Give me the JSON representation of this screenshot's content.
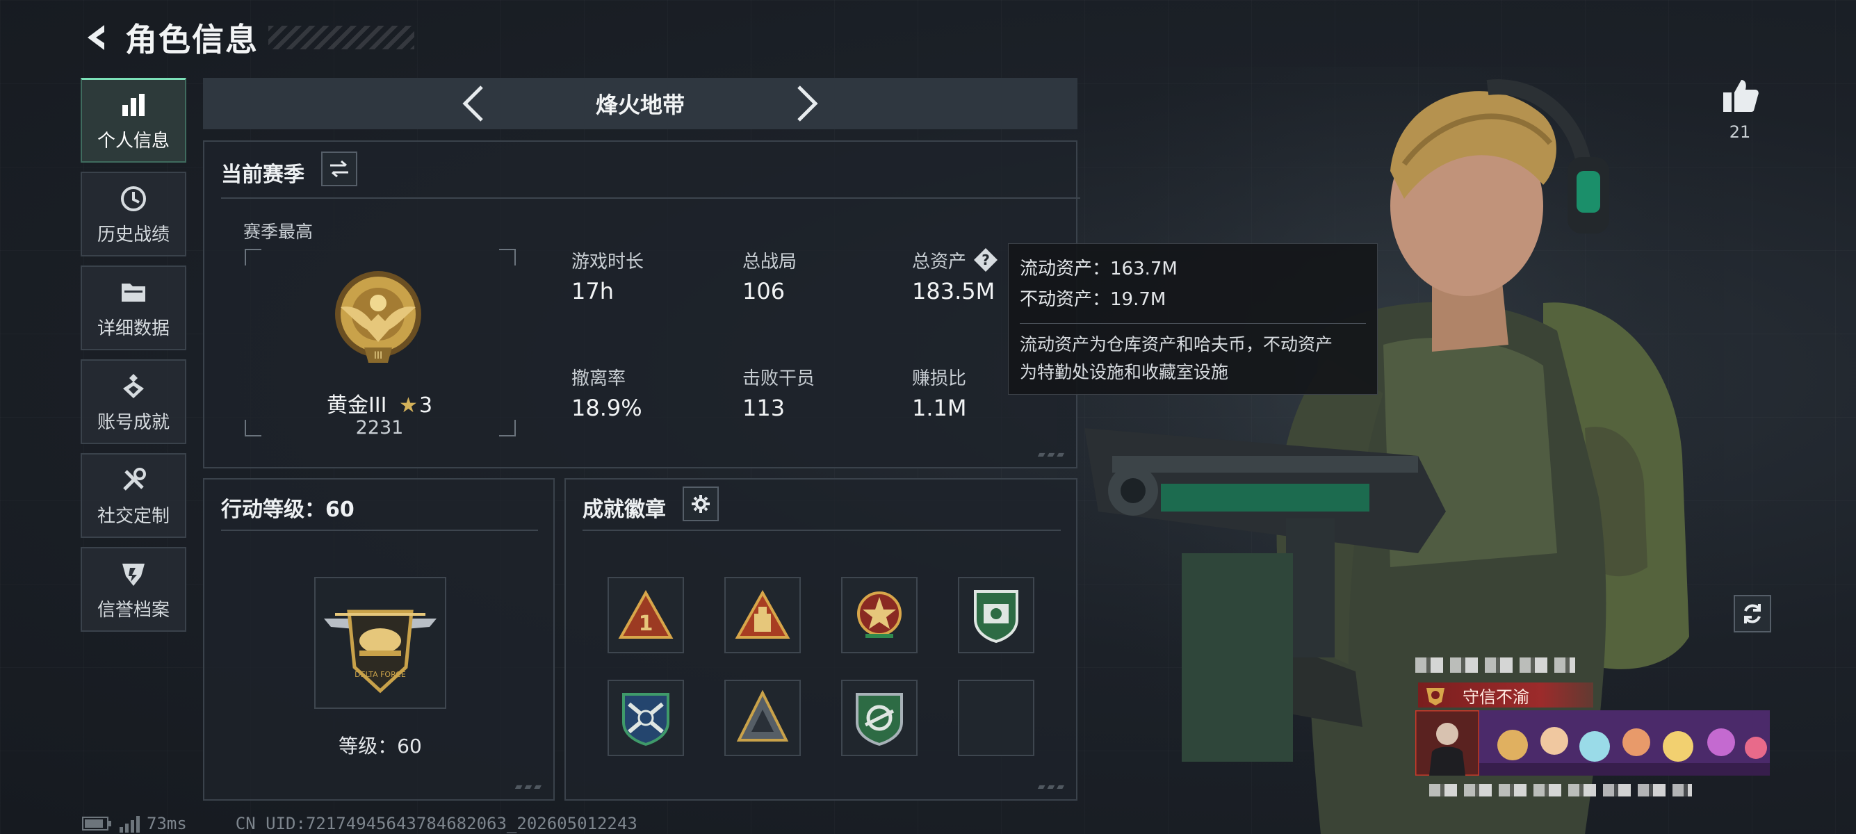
{
  "page": {
    "title": "角色信息"
  },
  "sidebar": {
    "items": [
      {
        "label": "个人信息",
        "icon": "bar-chart-icon",
        "active": true
      },
      {
        "label": "历史战绩",
        "icon": "history-icon"
      },
      {
        "label": "详细数据",
        "icon": "folder-icon"
      },
      {
        "label": "账号成就",
        "icon": "achievement-icon"
      },
      {
        "label": "社交定制",
        "icon": "tools-icon"
      },
      {
        "label": "信誉档案",
        "icon": "reputation-icon"
      }
    ]
  },
  "mode": {
    "name": "烽火地带"
  },
  "season": {
    "title": "当前赛季",
    "best_label": "赛季最高",
    "rank_name": "黄金III",
    "rank_stars": "3",
    "rank_score": "2231",
    "stats": [
      {
        "label": "游戏时长",
        "value": "17h"
      },
      {
        "label": "总战局",
        "value": "106"
      },
      {
        "label": "总资产",
        "value": "183.5M"
      },
      {
        "label": "撤离率",
        "value": "18.9%"
      },
      {
        "label": "击败干员",
        "value": "113"
      },
      {
        "label": "赚损比",
        "value": "1.1M"
      }
    ]
  },
  "tooltip": {
    "liquid": "流动资产：163.7M",
    "fixed": "不动资产：19.7M",
    "desc_line1": "流动资产为仓库资产和哈夫币，不动资产",
    "desc_line2": "为特勤处设施和收藏室设施"
  },
  "level": {
    "title": "行动等级：60",
    "label": "等级：60"
  },
  "badges": {
    "title": "成就徽章",
    "items": [
      {
        "icon": "triangle-number-one-badge-icon"
      },
      {
        "icon": "triangle-bunker-badge-icon"
      },
      {
        "icon": "red-medal-badge-icon"
      },
      {
        "icon": "green-shield-badge-icon"
      },
      {
        "icon": "blue-crossed-guns-shield-badge-icon"
      },
      {
        "icon": "grey-triangle-badge-icon"
      },
      {
        "icon": "green-cycle-shield-badge-icon"
      },
      {
        "icon": "empty-badge-slot"
      }
    ]
  },
  "likes": {
    "count": "21"
  },
  "card": {
    "honor": "守信不渝"
  },
  "footer": {
    "ping": "73ms",
    "uid": "CN UID:72174945643784682063_202605012243"
  },
  "colors": {
    "accent": "#7ce0b8",
    "gold": "#c9a24a",
    "honor_red": "#9c2b2b"
  }
}
